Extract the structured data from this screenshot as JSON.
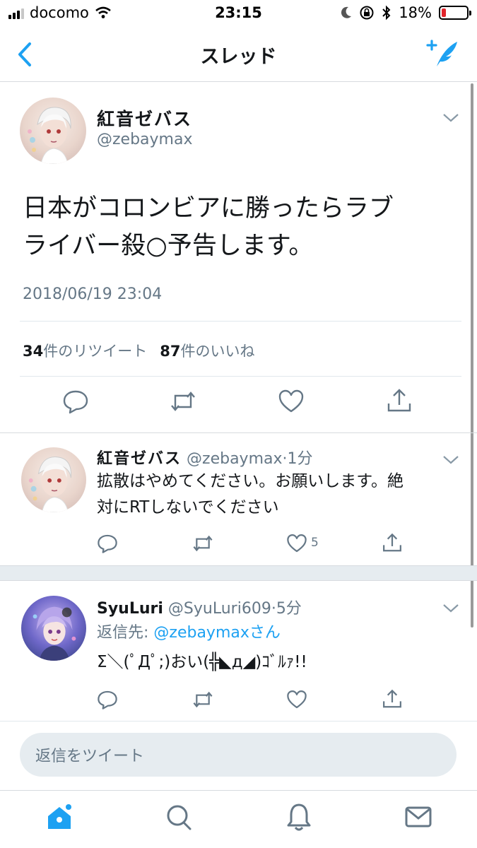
{
  "status_bar": {
    "carrier": "docomo",
    "time": "23:15",
    "battery_pct": "18%",
    "battery_level": 0.18
  },
  "nav": {
    "title": "スレッド"
  },
  "main_tweet": {
    "name": "紅音ゼバス",
    "handle": "@zebaymax",
    "text_line1": "日本がコロンビアに勝ったらラブ",
    "text_line2": "ライバー殺○予告します。",
    "timestamp": "2018/06/19 23:04",
    "retweets_count": "34",
    "retweets_label": "件のリツイート",
    "likes_count": "87",
    "likes_label": "件のいいね"
  },
  "replies": [
    {
      "name": "紅音ゼバス",
      "handle": "@zebaymax",
      "time": "1分",
      "text_line1": "拡散はやめてください。お願いします。絶",
      "text_line2": "対にRTしないでください",
      "like_count": "5"
    },
    {
      "name": "SyuLuri",
      "handle": "@SyuLuri609",
      "time": "5分",
      "replying_label": "返信先: ",
      "replying_to": "@zebaymaxさん",
      "text": "Σ＼(ﾟДﾟ;)おい(╬◣д◢)ｺﾞﾙｧ!!"
    }
  ],
  "reply_input": {
    "placeholder": "返信をツイート"
  },
  "colors": {
    "accent": "#1da1f2",
    "secondary_text": "#657786",
    "battery_low": "#e0242b"
  },
  "icons": [
    "back-icon",
    "compose-tweet-icon",
    "chevron-down-icon",
    "reply-icon",
    "retweet-icon",
    "like-icon",
    "share-icon",
    "home-icon",
    "search-icon",
    "notifications-icon",
    "messages-icon"
  ]
}
